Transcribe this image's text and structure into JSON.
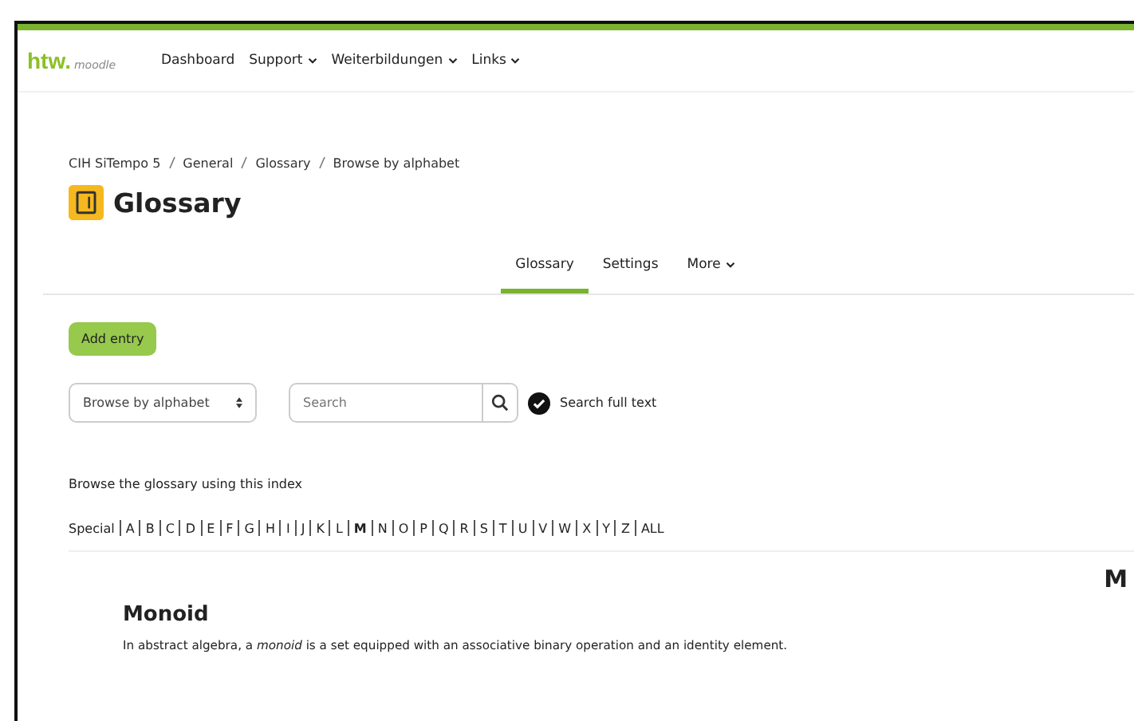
{
  "navbar": {
    "logo": "htw.",
    "logo_sub": "moodle",
    "items": [
      {
        "label": "Dashboard",
        "dropdown": false
      },
      {
        "label": "Support",
        "dropdown": true
      },
      {
        "label": "Weiterbildungen",
        "dropdown": true
      },
      {
        "label": "Links",
        "dropdown": true
      }
    ]
  },
  "breadcrumb": [
    "CIH SiTempo 5",
    "General",
    "Glossary",
    "Browse by alphabet"
  ],
  "page_title": "Glossary",
  "tabs": [
    {
      "label": "Glossary",
      "selected": true,
      "dropdown": false
    },
    {
      "label": "Settings",
      "selected": false,
      "dropdown": false
    },
    {
      "label": "More",
      "selected": false,
      "dropdown": true
    }
  ],
  "add_button": "Add entry",
  "browse_select": "Browse by alphabet",
  "search": {
    "placeholder": "Search"
  },
  "full_text": {
    "label": "Search full text",
    "checked": true
  },
  "index_caption": "Browse the glossary using this index",
  "letters": [
    {
      "label": "Special",
      "selected": false
    },
    {
      "label": "A",
      "selected": false
    },
    {
      "label": "B",
      "selected": false
    },
    {
      "label": "C",
      "selected": false
    },
    {
      "label": "D",
      "selected": false
    },
    {
      "label": "E",
      "selected": false
    },
    {
      "label": "F",
      "selected": false
    },
    {
      "label": "G",
      "selected": false
    },
    {
      "label": "H",
      "selected": false
    },
    {
      "label": "I",
      "selected": false
    },
    {
      "label": "J",
      "selected": false
    },
    {
      "label": "K",
      "selected": false
    },
    {
      "label": "L",
      "selected": false
    },
    {
      "label": "M",
      "selected": true
    },
    {
      "label": "N",
      "selected": false
    },
    {
      "label": "O",
      "selected": false
    },
    {
      "label": "P",
      "selected": false
    },
    {
      "label": "Q",
      "selected": false
    },
    {
      "label": "R",
      "selected": false
    },
    {
      "label": "S",
      "selected": false
    },
    {
      "label": "T",
      "selected": false
    },
    {
      "label": "U",
      "selected": false
    },
    {
      "label": "V",
      "selected": false
    },
    {
      "label": "W",
      "selected": false
    },
    {
      "label": "X",
      "selected": false
    },
    {
      "label": "Y",
      "selected": false
    },
    {
      "label": "Z",
      "selected": false
    },
    {
      "label": "ALL",
      "selected": false
    }
  ],
  "section_letter": "M",
  "entry": {
    "term": "Monoid",
    "definition": "In abstract algebra, a *monoid* is a set equipped with an associative binary operation and an identity element."
  }
}
